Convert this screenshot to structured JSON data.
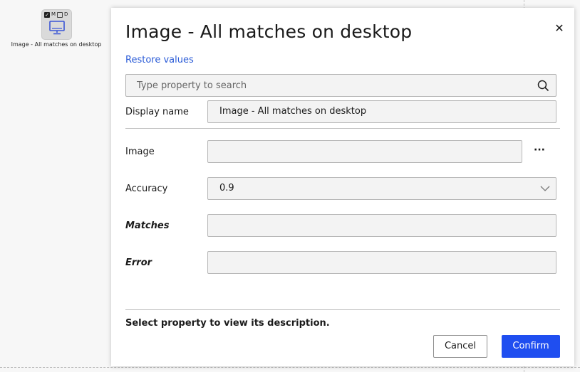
{
  "canvas": {
    "activity": {
      "badges": [
        "M",
        "D"
      ],
      "caption": "Image - All matches on desktop",
      "icon": "monitor-icon"
    }
  },
  "dialog": {
    "title": "Image - All matches on desktop",
    "close_icon": "close-icon",
    "restore_label": "Restore values",
    "search": {
      "placeholder": "Type property to search",
      "icon": "search-icon"
    },
    "display_name": {
      "label": "Display name",
      "value": "Image - All matches on desktop"
    },
    "properties": {
      "image": {
        "label": "Image",
        "value": "",
        "more_label": "···"
      },
      "accuracy": {
        "label": "Accuracy",
        "value": "0.9",
        "icon": "chevron-down-icon"
      },
      "matches": {
        "label": "Matches",
        "value": ""
      },
      "error": {
        "label": "Error",
        "value": ""
      }
    },
    "description": "Select property to view its description.",
    "buttons": {
      "cancel": "Cancel",
      "confirm": "Confirm"
    }
  },
  "colors": {
    "accent": "#1f4ef0",
    "link": "#2a5bd7"
  }
}
